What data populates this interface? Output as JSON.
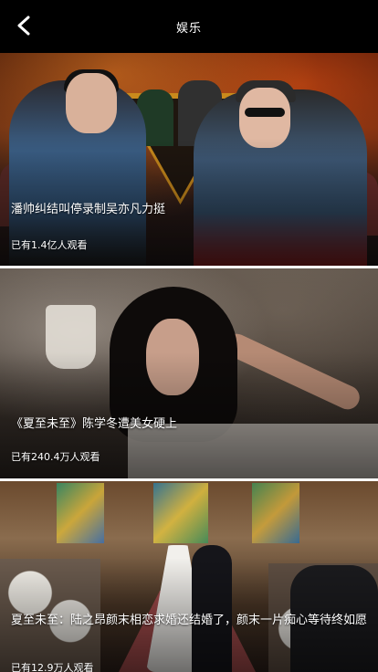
{
  "header": {
    "title": "娱乐",
    "back_icon": "chevron-left-icon"
  },
  "feed": {
    "items": [
      {
        "title": "潘帅纠结叫停录制吴亦凡力挺",
        "views": "已有1.4亿人观看"
      },
      {
        "title": "《夏至未至》陈学冬遭美女硬上",
        "views": "已有240.4万人观看"
      },
      {
        "title": "夏至未至：陆之昂颜末相恋求婚还结婚了，颜末一片痴心等待终如愿",
        "views": "已有12.9万人观看"
      }
    ]
  },
  "colors": {
    "header_bg": "#000000",
    "text": "#ffffff",
    "divider": "#ffffff"
  }
}
